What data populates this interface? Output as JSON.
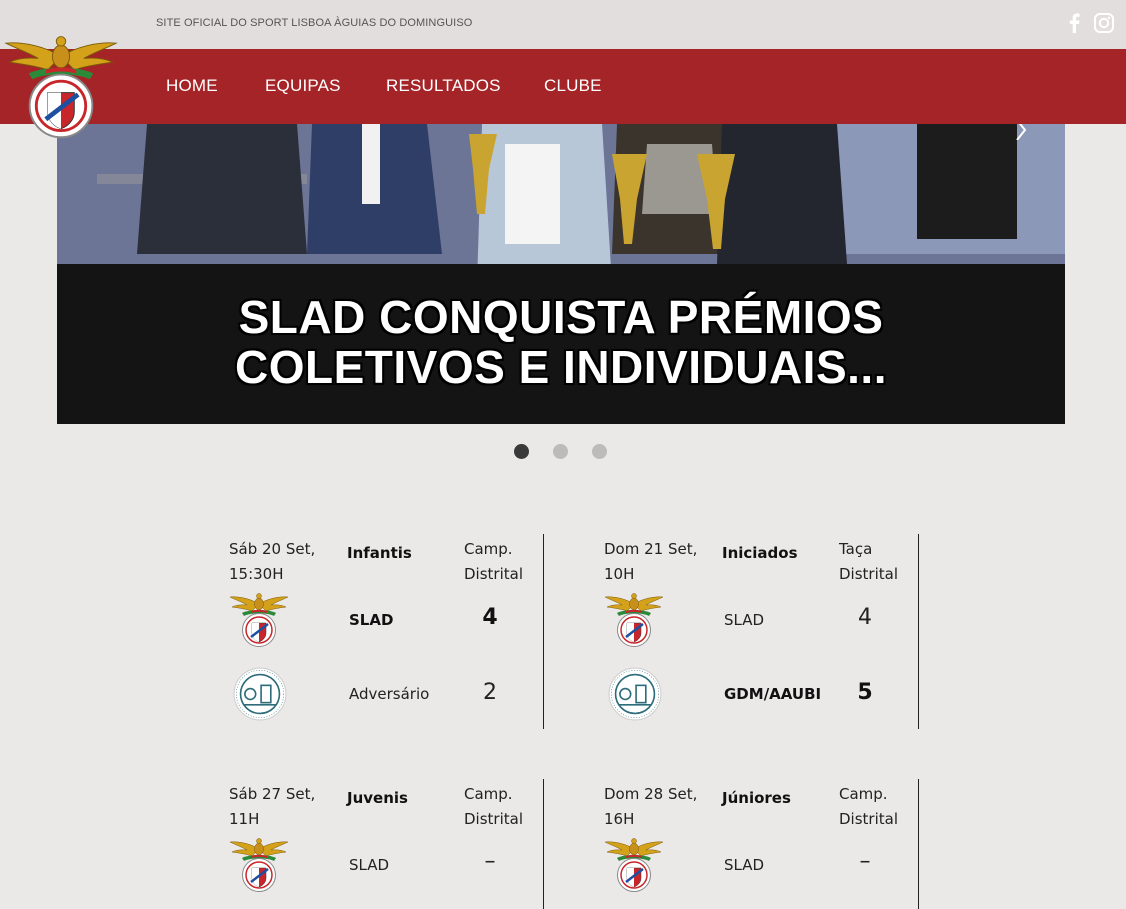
{
  "header": {
    "tagline": "SITE OFICIAL DO SPORT LISBOA ÀGUIAS DO DOMINGUISO",
    "social": [
      "facebook-icon",
      "instagram-icon"
    ]
  },
  "nav": {
    "items": [
      {
        "label": "HOME"
      },
      {
        "label": "EQUIPAS"
      },
      {
        "label": "RESULTADOS"
      },
      {
        "label": "CLUBE"
      }
    ]
  },
  "hero": {
    "title_line1": "SLAD CONQUISTA PRÉMIOS",
    "title_line2": "COLETIVOS E INDIVIDUAIS...",
    "slides": 3,
    "active_slide": 1
  },
  "colors": {
    "nav_bg": "#a52427",
    "topbar_bg": "#e2dede",
    "page_bg": "#ebe8e8"
  },
  "matches": [
    {
      "date_line1": "Sáb 20 Set,",
      "date_line2": "15:30H",
      "team": "Infantis",
      "comp_line1": "Camp.",
      "comp_line2": "Distrital",
      "home_name": "SLAD",
      "home_score": "4",
      "away_name": "Adversário",
      "away_score": "2"
    },
    {
      "date_line1": "Dom 21 Set,",
      "date_line2": "10H",
      "team": "Iniciados",
      "comp_line1": "Taça",
      "comp_line2": "Distrital",
      "home_name": "SLAD",
      "home_score": "4",
      "away_name": "GDM/AAUBI",
      "away_score": "5"
    },
    {
      "date_line1": "Sáb 27 Set,",
      "date_line2": "11H",
      "team": "Juvenis",
      "comp_line1": "Camp.",
      "comp_line2": "Distrital",
      "home_name": "SLAD",
      "home_score": "–"
    },
    {
      "date_line1": "Dom 28 Set,",
      "date_line2": "16H",
      "team": "Júniores",
      "comp_line1": "Camp.",
      "comp_line2": "Distrital",
      "home_name": "SLAD",
      "home_score": "–"
    }
  ]
}
